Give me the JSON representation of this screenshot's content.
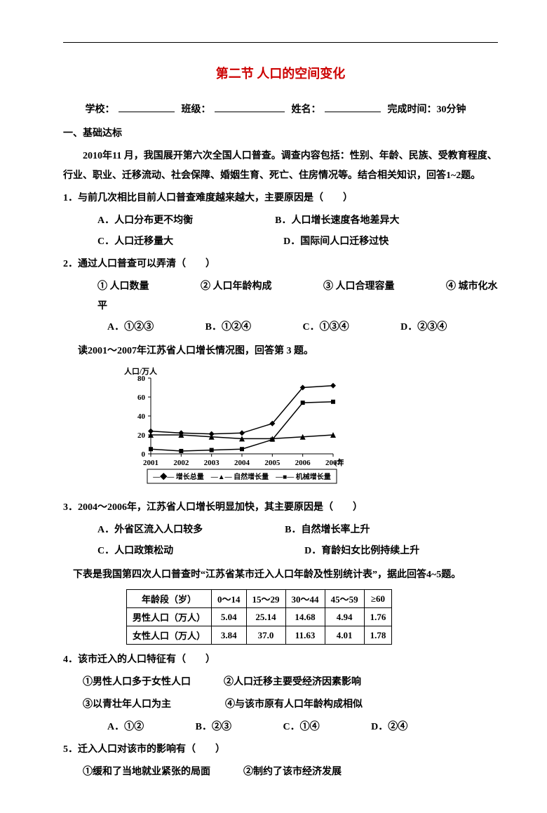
{
  "title": "第二节 人口的空间变化",
  "form": {
    "school_label": "学校：",
    "class_label": "班级：",
    "name_label": "姓名：",
    "time_label": "完成时间：30分钟"
  },
  "section1": "一、基础达标",
  "intro": "2010年11 月，我国展开第六次全国人口普查。调查内容包括：性别、年龄、民族、受教育程度、行业、职业、迁移流动、社会保障、婚姻生育、死亡、住房情况等。结合相关知识，回答1~2题。",
  "q1": {
    "stem": "1．与前几次相比目前人口普查难度越来越大，主要原因是（　　）",
    "A": "A．人口分布更不均衡",
    "B": "B．人口增长速度各地差异大",
    "C": "C．人口迁移量大",
    "D": "D．国际间人口迁移过快"
  },
  "q2": {
    "stem": "2．通过人口普查可以弄清（　　）",
    "o1": "① 人口数量",
    "o2": "② 人口年龄构成",
    "o3": "③ 人口合理容量",
    "o4": "④ 城市化水平",
    "A": "A．①②③",
    "B": "B．①②④",
    "C": "C．①③④",
    "D": "D．②③④"
  },
  "chart_caption": "读2001～2007年江苏省人口增长情况图，回答第 3 题。",
  "chart_data": {
    "type": "line",
    "title": "",
    "ylabel": "人口/万人",
    "xlabel": "(年)",
    "x": [
      2001,
      2002,
      2003,
      2004,
      2005,
      2006,
      2007
    ],
    "ylim": [
      0,
      80
    ],
    "yticks": [
      0,
      20,
      40,
      60,
      80
    ],
    "series": [
      {
        "name": "增长总量",
        "marker": "diamond",
        "values": [
          24,
          22,
          21,
          22,
          32,
          70,
          72
        ]
      },
      {
        "name": "自然增长量",
        "marker": "triangle",
        "values": [
          20,
          20,
          18,
          16,
          16,
          18,
          20
        ]
      },
      {
        "name": "机械增长量",
        "marker": "square",
        "values": [
          5,
          3,
          4,
          5,
          15,
          54,
          55
        ]
      }
    ],
    "legend": "—◆— 增长总量　—▲— 自然增长量　—■— 机械增长量"
  },
  "q3": {
    "stem": "3．2004～2006年，江苏省人口增长明显加快，其主要原因是（　　）",
    "A": "A．外省区流入人口较多",
    "B": "B．自然增长率上升",
    "C": "C．人口政策松动",
    "D": "D．育龄妇女比例持续上升"
  },
  "table_caption": "下表是我国第四次人口普查时“江苏省某市迁入人口年龄及性别统计表”，据此回答4~5题。",
  "table": {
    "headers": [
      "年龄段（岁）",
      "0～14",
      "15～29",
      "30～44",
      "45～59",
      "≥60"
    ],
    "rows": [
      [
        "男性人口（万人）",
        "5.04",
        "25.14",
        "14.68",
        "4.94",
        "1.76"
      ],
      [
        "女性人口（万人）",
        "3.84",
        "37.0",
        "11.63",
        "4.01",
        "1.78"
      ]
    ]
  },
  "q4": {
    "stem": "4．该市迁入的人口特征有（　　）",
    "o1": "①男性人口多于女性人口",
    "o2": "②人口迁移主要受经济因素影响",
    "o3": "③以青壮年人口为主",
    "o4": "④与该市原有人口年龄构成相似",
    "A": "A．①②",
    "B": "B．②③",
    "C": "C．①④",
    "D": "D．②④"
  },
  "q5": {
    "stem": "5．迁入人口对该市的影响有（　　）",
    "o1": "①缓和了当地就业紧张的局面",
    "o2": "②制约了该市经济发展"
  }
}
